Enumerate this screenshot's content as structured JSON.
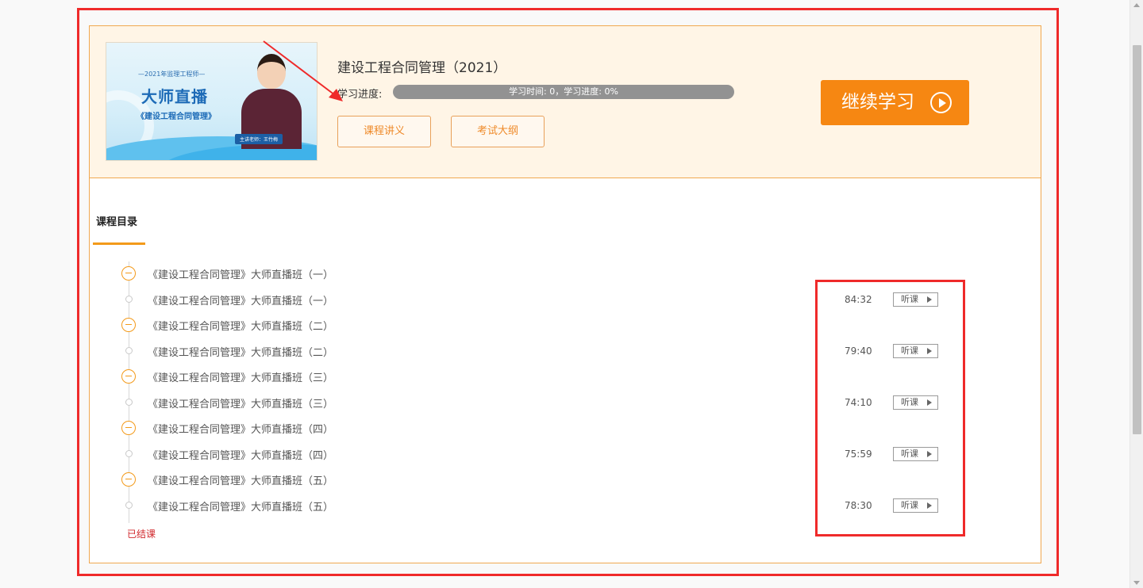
{
  "course": {
    "title": "建设工程合同管理（2021）",
    "progress_label": "学习进度:",
    "progress_text": "学习时间: 0，学习进度: 0%",
    "progress_value": 0,
    "notes_button": "课程讲义",
    "syllabus_button": "考试大纲",
    "continue_button": "继续学习"
  },
  "thumbnail": {
    "top_line": "—2021年监理工程师—",
    "headline": "大师直播",
    "subtitle": "《建设工程合同管理》",
    "teacher_tag": "主讲老师：王竹梅"
  },
  "catalog": {
    "title": "课程目录",
    "items": [
      {
        "type": "chapter",
        "label": "《建设工程合同管理》大师直播班（一）"
      },
      {
        "type": "lesson",
        "label": "《建设工程合同管理》大师直播班（一）",
        "duration": "84:32",
        "action": "听课"
      },
      {
        "type": "chapter",
        "label": "《建设工程合同管理》大师直播班（二）"
      },
      {
        "type": "lesson",
        "label": "《建设工程合同管理》大师直播班（二）",
        "duration": "79:40",
        "action": "听课"
      },
      {
        "type": "chapter",
        "label": "《建设工程合同管理》大师直播班（三）"
      },
      {
        "type": "lesson",
        "label": "《建设工程合同管理》大师直播班（三）",
        "duration": "74:10",
        "action": "听课"
      },
      {
        "type": "chapter",
        "label": "《建设工程合同管理》大师直播班（四）"
      },
      {
        "type": "lesson",
        "label": "《建设工程合同管理》大师直播班（四）",
        "duration": "75:59",
        "action": "听课"
      },
      {
        "type": "chapter",
        "label": "《建设工程合同管理》大师直播班（五）"
      },
      {
        "type": "lesson",
        "label": "《建设工程合同管理》大师直播班（五）",
        "duration": "78:30",
        "action": "听课"
      }
    ],
    "status": "已结课"
  },
  "colors": {
    "accent": "#f68712",
    "annotation_red": "#ef2a2a",
    "header_bg": "#fff5e6",
    "status_red": "#d0282c"
  }
}
